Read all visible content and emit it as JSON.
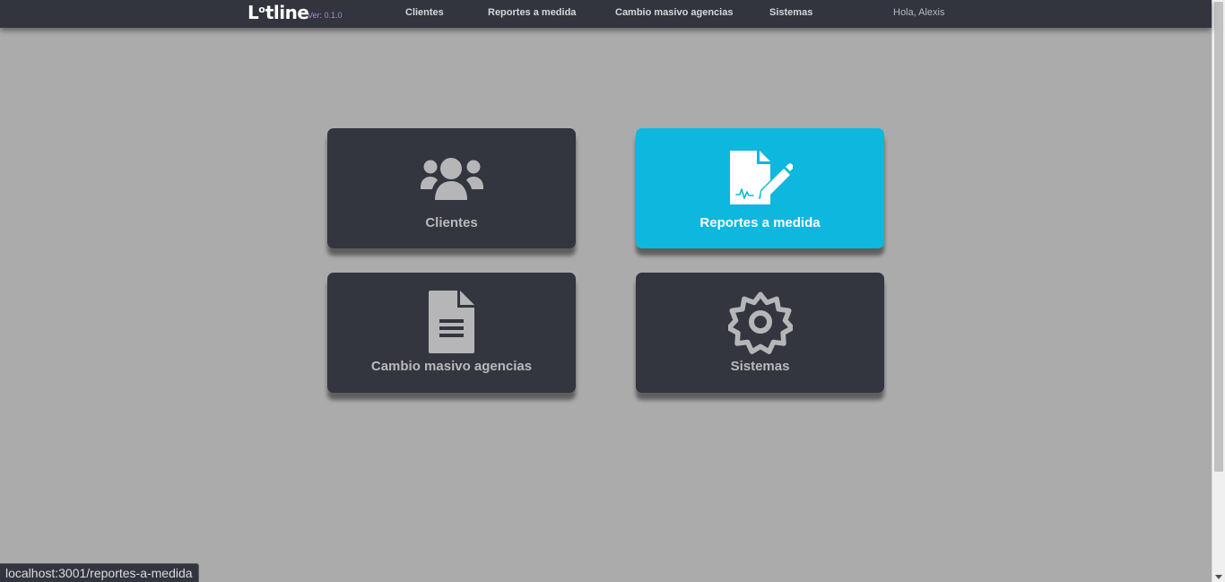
{
  "brand": {
    "logo_main": "L",
    "logo_sup": "o",
    "logo_rest": "tline",
    "version": "Ver: 0.1.0"
  },
  "nav": {
    "items": [
      {
        "label": "Clientes"
      },
      {
        "label": "Reportes a medida"
      },
      {
        "label": "Cambio masivo agencias"
      },
      {
        "label": "Sistemas"
      }
    ],
    "greeting": "Hola, Alexis"
  },
  "cards": [
    {
      "label": "Clientes",
      "icon": "users-icon",
      "active": false
    },
    {
      "label": "Reportes a medida",
      "icon": "file-signature-icon",
      "active": true
    },
    {
      "label": "Cambio masivo agencias",
      "icon": "file-alt-icon",
      "active": false
    },
    {
      "label": "Sistemas",
      "icon": "gear-icon",
      "active": false
    }
  ],
  "status_bar": {
    "url": "localhost:3001/reportes-a-medida"
  },
  "colors": {
    "nav_bg": "#32353d",
    "card_bg": "#33363e",
    "active_card_bg": "#0db7de",
    "page_bg": "#ababab",
    "version_text": "#a78fce"
  }
}
